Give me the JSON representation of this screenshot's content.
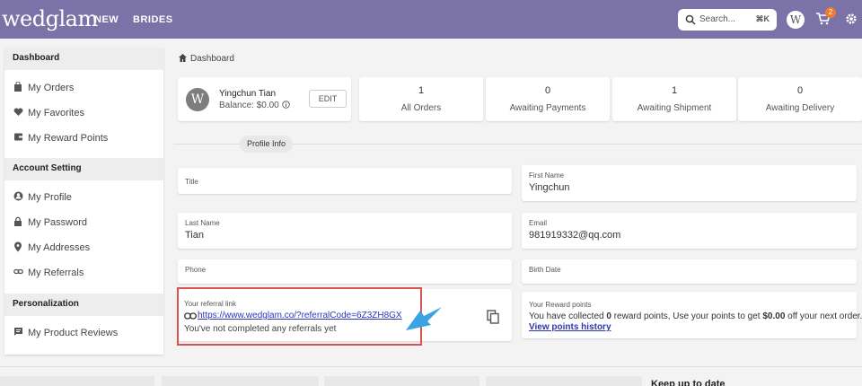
{
  "header": {
    "logo": "wedglam",
    "nav": [
      "NEW",
      "BRIDES"
    ],
    "search_placeholder": "Search...",
    "search_shortcut": "⌘K",
    "avatar_letter": "W",
    "cart_count": "2"
  },
  "sidebar": {
    "sections": [
      {
        "title": "Dashboard",
        "items": [
          {
            "label": "My Orders",
            "icon": "bag-icon"
          },
          {
            "label": "My Favorites",
            "icon": "heart-icon"
          },
          {
            "label": "My Reward Points",
            "icon": "wallet-icon"
          }
        ]
      },
      {
        "title": "Account Setting",
        "items": [
          {
            "label": "My Profile",
            "icon": "person-icon"
          },
          {
            "label": "My Password",
            "icon": "lock-icon"
          },
          {
            "label": "My Addresses",
            "icon": "pin-icon"
          },
          {
            "label": "My Referrals",
            "icon": "link-icon"
          }
        ]
      },
      {
        "title": "Personalization",
        "items": [
          {
            "label": "My Product Reviews",
            "icon": "review-icon"
          }
        ]
      }
    ]
  },
  "breadcrumb": "Dashboard",
  "profile": {
    "name": "Yingchun Tian",
    "balance": "Balance:  $0.00",
    "edit_label": "EDIT"
  },
  "stats": [
    {
      "value": "1",
      "label": "All Orders"
    },
    {
      "value": "0",
      "label": "Awaiting Payments"
    },
    {
      "value": "1",
      "label": "Awaiting Shipment"
    },
    {
      "value": "0",
      "label": "Awaiting Delivery"
    }
  ],
  "profile_info_label": "Profile Info",
  "fields": {
    "title": {
      "label": "Title",
      "value": ""
    },
    "first_name": {
      "label": "First Name",
      "value": "Yingchun"
    },
    "last_name": {
      "label": "Last Name",
      "value": "Tian"
    },
    "email": {
      "label": "Email",
      "value": "981919332@qq.com"
    },
    "phone": {
      "label": "Phone",
      "value": ""
    },
    "birth_date": {
      "label": "Birth Date",
      "value": ""
    }
  },
  "referral": {
    "label": "Your referral link",
    "link": "https://www.wedglam.co/?referralCode=6Z3ZH8GX",
    "note": "You've not completed any referrals yet"
  },
  "reward": {
    "label": "Your Reward points",
    "text_1": "You have collected ",
    "points": "0",
    "text_2": " reward points, Use your points to get ",
    "amount": "$0.00",
    "text_3": " off your next order.",
    "history_link": "View points history"
  },
  "footer": {
    "keep_up": "Keep up to date"
  },
  "colors": {
    "header_bg": "#7b72a8",
    "highlight_border": "#d9534f",
    "link": "#2d34b8",
    "arrow": "#3aa3e3"
  }
}
